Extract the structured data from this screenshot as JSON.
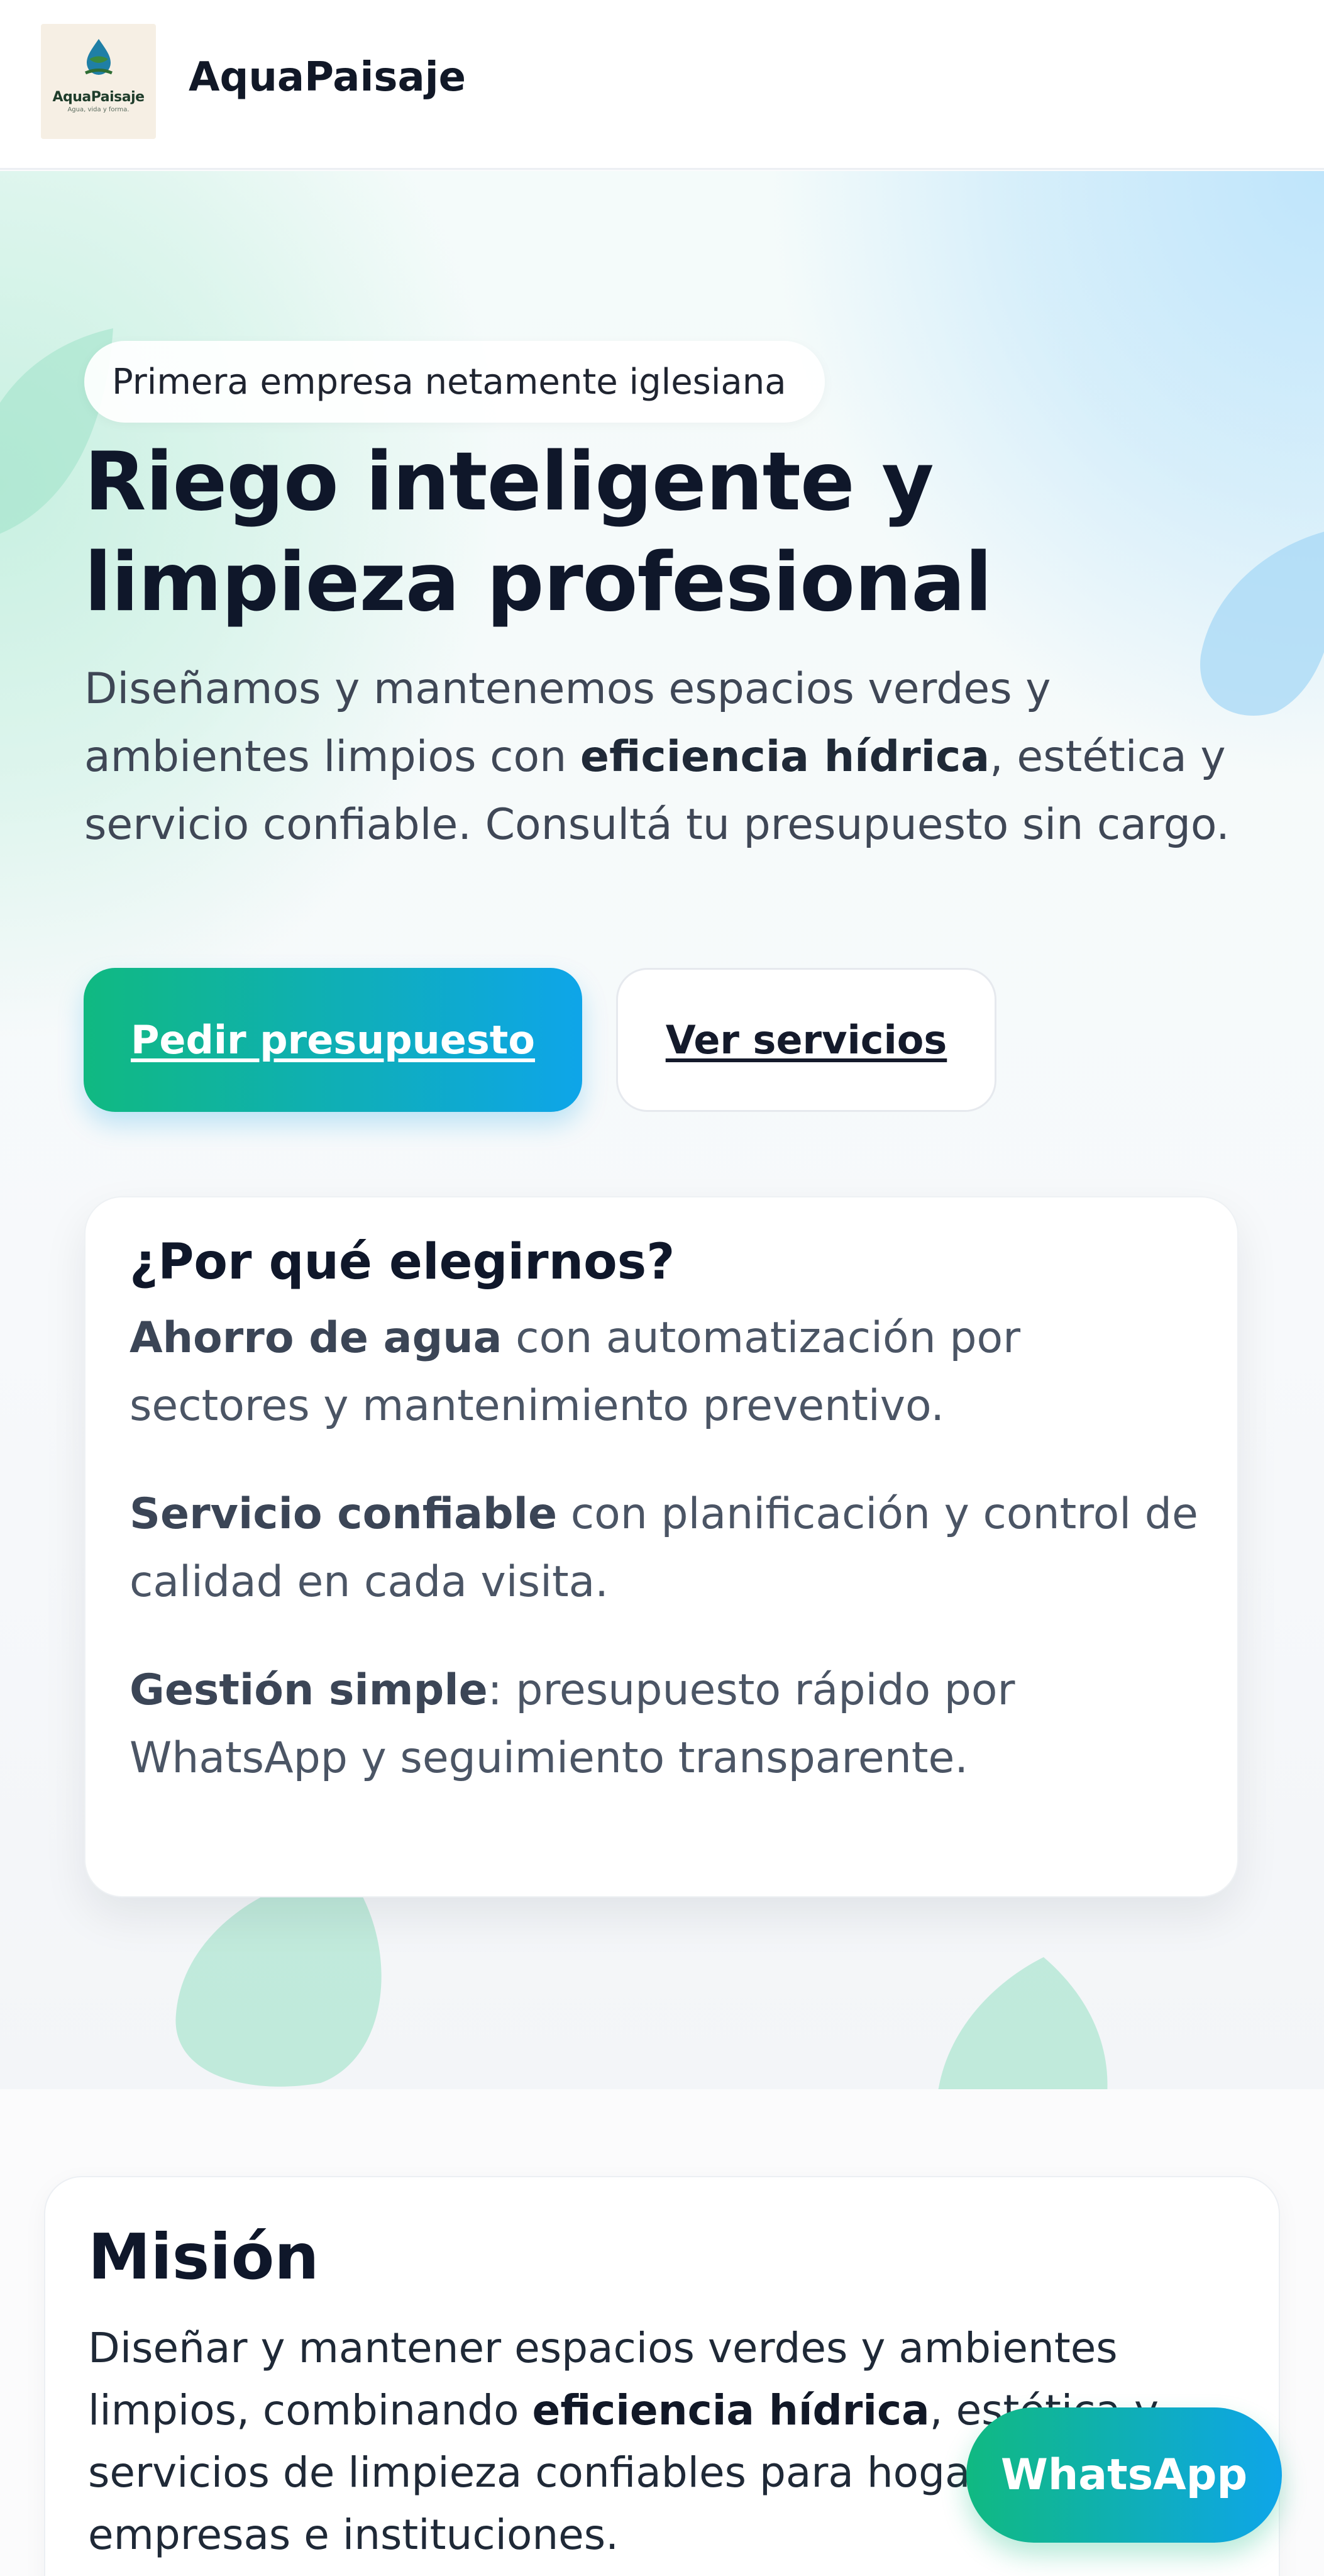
{
  "header": {
    "logo_name": "AquaPaisaje",
    "logo_tagline": "Agua, vida y forma.",
    "brand": "AquaPaisaje"
  },
  "hero": {
    "badge": "Primera empresa netamente iglesiana",
    "title_line1": "Riego inteligente y",
    "title_line2": "limpieza profesional",
    "lead_before": "Diseñamos y mantenemos espacios verdes y ambientes limpios con ",
    "lead_bold": "eficiencia hídrica",
    "lead_after": ", estética y servicio confiable. Consultá tu presupuesto sin cargo.",
    "primary_button": "Pedir presupuesto",
    "secondary_button": "Ver servicios"
  },
  "why": {
    "title": "¿Por qué elegirnos?",
    "items": [
      {
        "bold": "Ahorro de agua",
        "text": " con automatización por sectores y mantenimiento preventivo."
      },
      {
        "bold": "Servicio confiable",
        "text": " con planificación y control de calidad en cada visita."
      },
      {
        "bold": "Gestión simple",
        "text": ": presupuesto rápido por WhatsApp y seguimiento transparente."
      }
    ]
  },
  "mission": {
    "title": "Misión",
    "text_before": "Diseñar y mantener espacios verdes y ambientes limpios, combinando ",
    "text_bold": "eficiencia hídrica",
    "text_after": ", estética y servicios de limpieza confiables para hogares, empresas e instituciones."
  },
  "whatsapp_button": "WhatsApp",
  "colors": {
    "accent_green": "#10b981",
    "accent_blue": "#0ea5e9",
    "text_dark": "#0f172a"
  }
}
